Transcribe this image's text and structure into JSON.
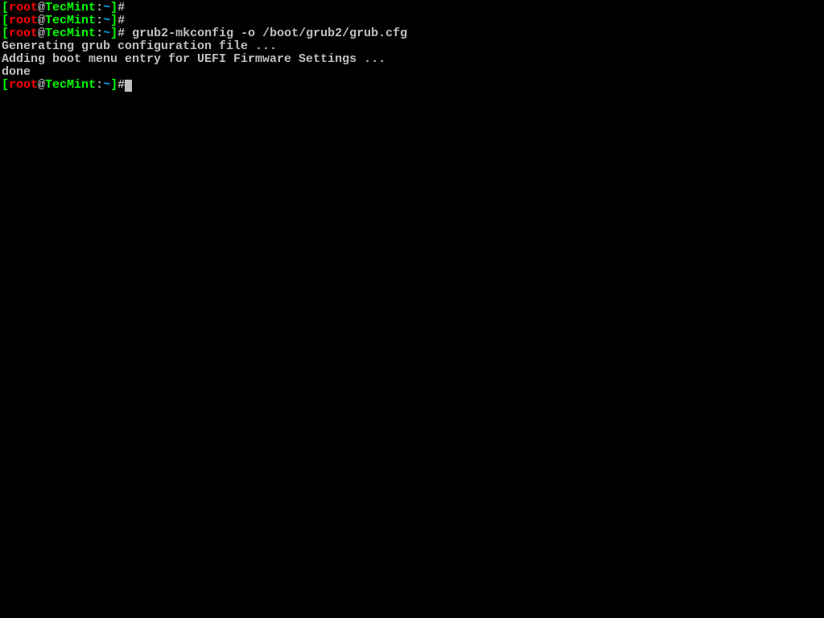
{
  "prompt": {
    "open_bracket": "[",
    "user": "root",
    "at": "@",
    "host": "TecMint",
    "colon": ":",
    "path": "~",
    "close_bracket": "]",
    "hash": "#"
  },
  "lines": {
    "line1_command": "",
    "line2_command": "",
    "line3_command": " grub2-mkconfig -o /boot/grub2/grub.cfg",
    "output1": "Generating grub configuration file ...",
    "output2": "Adding boot menu entry for UEFI Firmware Settings ...",
    "output3": "done",
    "line4_command": ""
  }
}
